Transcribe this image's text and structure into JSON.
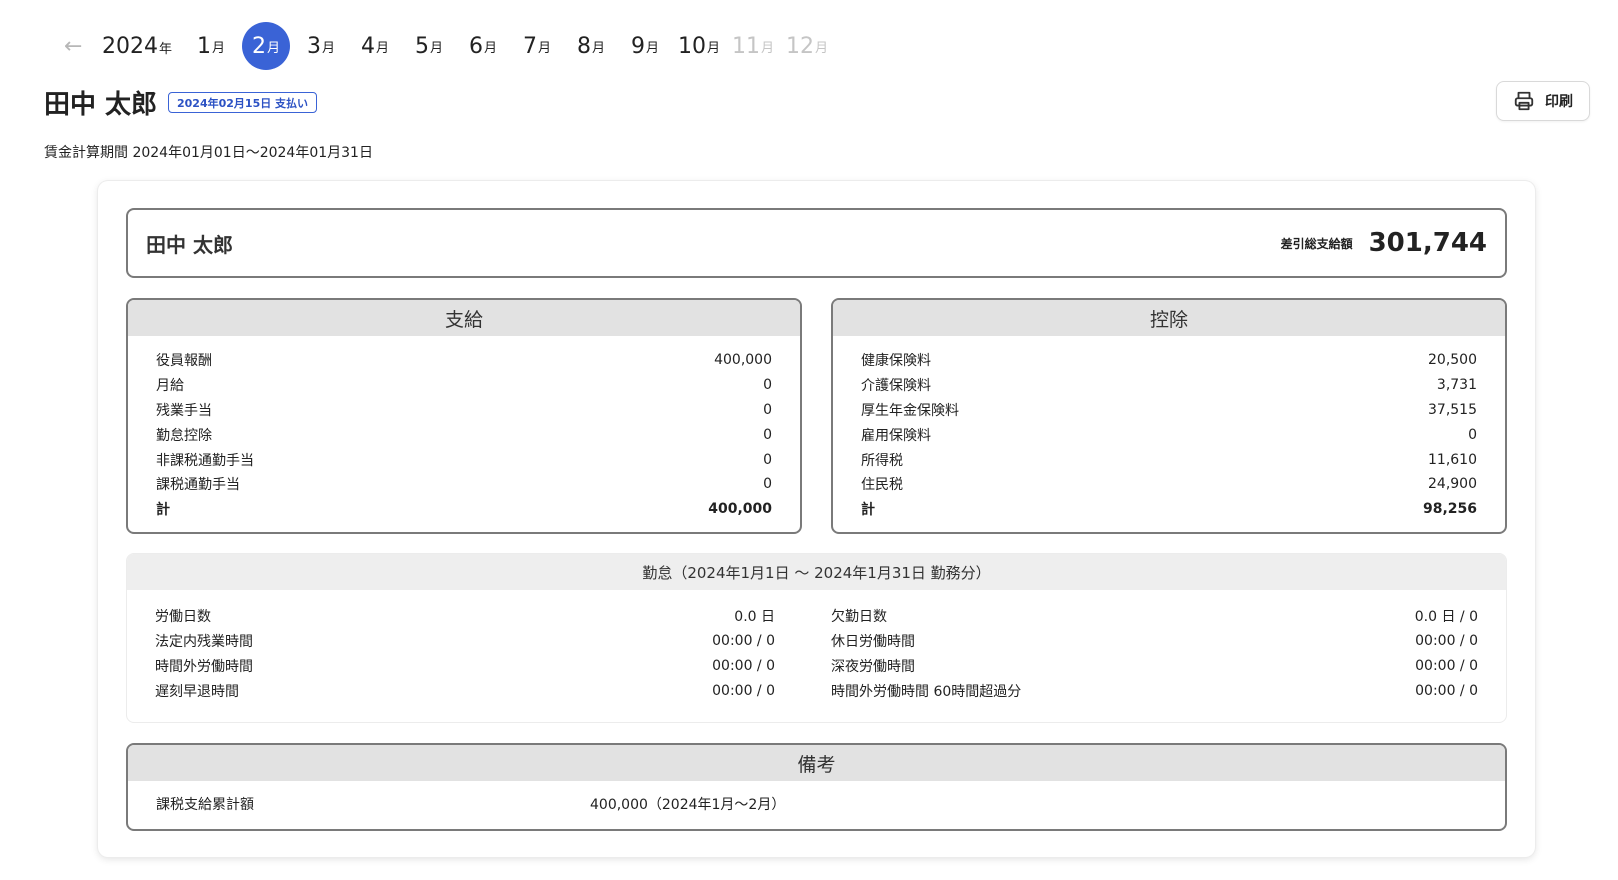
{
  "nav": {
    "back_icon": "arrow-left-icon",
    "year": "2024",
    "year_unit": "年",
    "month_unit": "月",
    "months": [
      {
        "label": "1",
        "state": "normal"
      },
      {
        "label": "2",
        "state": "active"
      },
      {
        "label": "3",
        "state": "normal"
      },
      {
        "label": "4",
        "state": "normal"
      },
      {
        "label": "5",
        "state": "normal"
      },
      {
        "label": "6",
        "state": "normal"
      },
      {
        "label": "7",
        "state": "normal"
      },
      {
        "label": "8",
        "state": "normal"
      },
      {
        "label": "9",
        "state": "normal"
      },
      {
        "label": "10",
        "state": "normal"
      },
      {
        "label": "11",
        "state": "disabled"
      },
      {
        "label": "12",
        "state": "disabled"
      }
    ],
    "active_color": "#3a63d6"
  },
  "header": {
    "employee_name": "田中 太郎",
    "payment_badge": "2024年02月15日 支払い",
    "print_label": "印刷",
    "print_icon": "printer-icon",
    "period": "賃金計算期間 2024年01月01日〜2024年01月31日"
  },
  "summary": {
    "name": "田中 太郎",
    "net_label": "差引総支給額",
    "net_value": "301,744"
  },
  "payments": {
    "title": "支給",
    "rows": [
      {
        "label": "役員報酬",
        "value": "400,000"
      },
      {
        "label": "月給",
        "value": "0"
      },
      {
        "label": "残業手当",
        "value": "0"
      },
      {
        "label": "勤怠控除",
        "value": "0"
      },
      {
        "label": "非課税通勤手当",
        "value": "0"
      },
      {
        "label": "課税通勤手当",
        "value": "0"
      }
    ],
    "total_label": "計",
    "total_value": "400,000"
  },
  "deductions": {
    "title": "控除",
    "rows": [
      {
        "label": "健康保険料",
        "value": "20,500"
      },
      {
        "label": "介護保険料",
        "value": "3,731"
      },
      {
        "label": "厚生年金保険料",
        "value": "37,515"
      },
      {
        "label": "雇用保険料",
        "value": "0"
      },
      {
        "label": "所得税",
        "value": "11,610"
      },
      {
        "label": "住民税",
        "value": "24,900"
      }
    ],
    "total_label": "計",
    "total_value": "98,256"
  },
  "attendance": {
    "title": "勤怠（2024年1月1日 〜 2024年1月31日 勤務分）",
    "left": [
      {
        "label": "労働日数",
        "value": "0.0 日"
      },
      {
        "label": "法定内残業時間",
        "value": "00:00 / 0"
      },
      {
        "label": "時間外労働時間",
        "value": "00:00 / 0"
      },
      {
        "label": "遅刻早退時間",
        "value": "00:00 / 0"
      }
    ],
    "right": [
      {
        "label": "欠勤日数",
        "value": "0.0 日 / 0"
      },
      {
        "label": "休日労働時間",
        "value": "00:00 / 0"
      },
      {
        "label": "深夜労働時間",
        "value": "00:00 / 0"
      },
      {
        "label": "時間外労働時間 60時間超過分",
        "value": "00:00 / 0"
      }
    ]
  },
  "notes": {
    "title": "備考",
    "label": "課税支給累計額",
    "value": "400,000（2024年1月〜2月）"
  }
}
